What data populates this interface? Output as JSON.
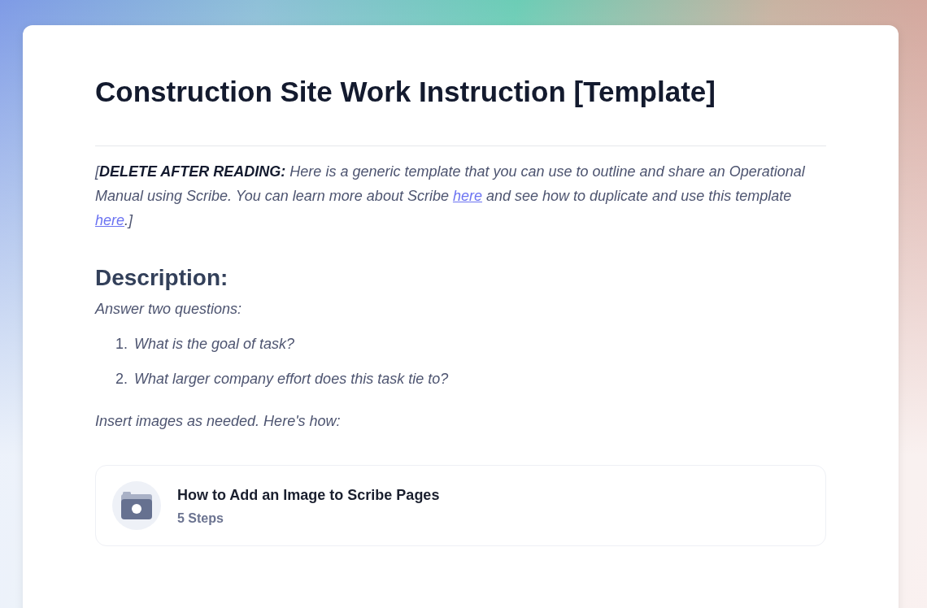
{
  "document": {
    "title": "Construction Site Work Instruction [Template]",
    "intro": [
      {
        "kind": "text",
        "text": "[**DELETE AFTER READING:** Here is a generic template that you can use to outline and share an Operational Manual using Scribe. You can learn more about Scribe "
      },
      {
        "kind": "link",
        "text": "here"
      },
      {
        "kind": "text",
        "text": " and see how to duplicate and use this template "
      },
      {
        "kind": "link",
        "text": "here"
      },
      {
        "kind": "text",
        "text": ".]"
      }
    ],
    "section_heading": "Description:",
    "prompt": "Answer two questions:",
    "questions": [
      {
        "number": "1.",
        "text": "What is the goal of task?"
      },
      {
        "number": "2.",
        "text": "What larger company effort does this task tie to?"
      }
    ],
    "note": "Insert images as needed. Here's how:",
    "embed": {
      "title": "How to Add an Image to Scribe Pages",
      "subtitle": "5 Steps"
    }
  }
}
